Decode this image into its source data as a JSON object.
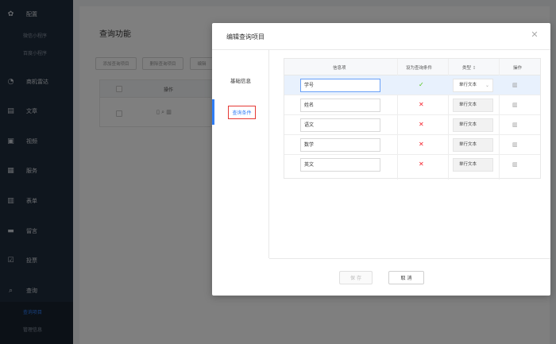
{
  "sidebar": {
    "items": [
      {
        "icon": "gear-icon",
        "label": "配置"
      },
      {
        "icon": "pie-chart-icon",
        "label": "商机雷达"
      },
      {
        "icon": "document-icon",
        "label": "文章"
      },
      {
        "icon": "video-icon",
        "label": "视频"
      },
      {
        "icon": "service-icon",
        "label": "服务"
      },
      {
        "icon": "form-icon",
        "label": "表单"
      },
      {
        "icon": "message-icon",
        "label": "留言"
      },
      {
        "icon": "vote-icon",
        "label": "投票"
      },
      {
        "icon": "query-icon",
        "label": "查询"
      }
    ],
    "sub_config": [
      "微信小程序",
      "百度小程序"
    ],
    "sub_query": [
      "查询项目",
      "管理信息"
    ]
  },
  "page": {
    "title": "查询功能",
    "buttons": [
      "添加查询项目",
      "删除查询项目",
      "编辑"
    ],
    "table_header_action": "操作"
  },
  "modal": {
    "title": "编辑查询项目",
    "tabs": [
      "基础信息",
      "查询条件"
    ],
    "columns": {
      "item": "信息项",
      "condition": "设为查询条件",
      "type": "类型",
      "action": "操作"
    },
    "rows": [
      {
        "value": "学号",
        "is_condition": true,
        "type": "单行文本"
      },
      {
        "value": "姓名",
        "is_condition": false,
        "type": "单行文本"
      },
      {
        "value": "语文",
        "is_condition": false,
        "type": "单行文本"
      },
      {
        "value": "数学",
        "is_condition": false,
        "type": "单行文本"
      },
      {
        "value": "英文",
        "is_condition": false,
        "type": "单行文本"
      }
    ],
    "yes_mark": "✓",
    "no_mark": "✕",
    "save_label": "保 存",
    "cancel_label": "取 消"
  }
}
